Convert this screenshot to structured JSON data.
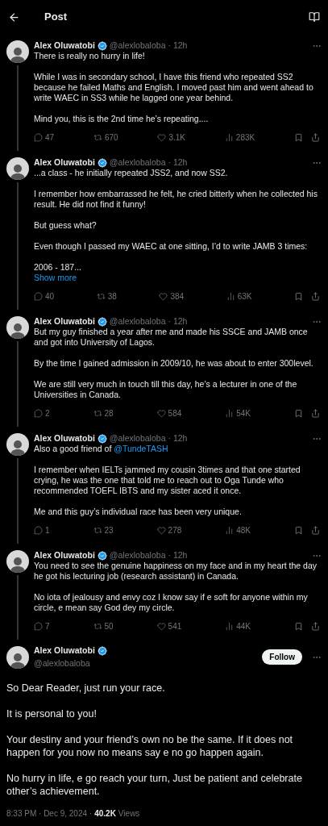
{
  "header": {
    "title": "Post"
  },
  "separator": "·",
  "thread": [
    {
      "name": "Alex Oluwatobi",
      "handle": "@alexlobaloba",
      "time": "12h",
      "paragraphs": [
        "There is really no hurry in life!",
        "While I was in secondary school, I have this friend who repeated SS2 because he failed Maths and English. I moved past him and went ahead to write WAEC in SS3 while he lagged one year behind.",
        "Mind you, this is the 2nd time he’s repeating...."
      ],
      "stats": {
        "replies": "47",
        "reposts": "670",
        "likes": "3.1K",
        "views": "283K"
      }
    },
    {
      "name": "Alex Oluwatobi",
      "handle": "@alexlobaloba",
      "time": "12h",
      "paragraphs": [
        "...a class - he initially repeated JSS2, and now SS2.",
        "I remember how embarrassed he felt, he cried bitterly when he collected his result. He did not find it funny!",
        "But guess what?",
        "Even though I passed my WAEC at one sitting, I’d to write JAMB 3 times:",
        "2006 - 187..."
      ],
      "show_more": "Show more",
      "stats": {
        "replies": "40",
        "reposts": "38",
        "likes": "384",
        "views": "63K"
      }
    },
    {
      "name": "Alex Oluwatobi",
      "handle": "@alexlobaloba",
      "time": "12h",
      "paragraphs": [
        "But my guy finished a year after me and made his SSCE and JAMB once and got into University of Lagos.",
        "By the time I gained admission in 2009/10, he was about to enter 300level.",
        "We are still very much in touch till this day, he’s a lecturer in one of the Universities in Canada."
      ],
      "stats": {
        "replies": "2",
        "reposts": "28",
        "likes": "584",
        "views": "54K"
      }
    },
    {
      "name": "Alex Oluwatobi",
      "handle": "@alexlobaloba",
      "time": "12h",
      "paragraphs": [
        {
          "text": "Also a good friend of",
          "mention": "@TundeTASH"
        },
        "I remember when IELTs jammed my cousin 3times and that one started crying, he was the one that told me to reach out to Oga Tunde who recommended TOEFL IBTS and my sister aced it once.",
        "Me and this guy’s individual race has been very unique."
      ],
      "stats": {
        "replies": "1",
        "reposts": "23",
        "likes": "278",
        "views": "48K"
      }
    },
    {
      "name": "Alex Oluwatobi",
      "handle": "@alexlobaloba",
      "time": "12h",
      "paragraphs": [
        "You need to see the genuine happiness on my face and in my heart the day he got his lecturing job (research assistant) in Canada.",
        "No iota of jealousy and envy coz I know say if e soft for anyone within my circle, e mean say God dey my circle."
      ],
      "stats": {
        "replies": "7",
        "reposts": "50",
        "likes": "541",
        "views": "44K"
      }
    }
  ],
  "main_post": {
    "name": "Alex Oluwatobi",
    "handle": "@alexlobaloba",
    "follow_label": "Follow",
    "paragraphs": [
      "So Dear Reader, just run your race.",
      "It is personal to you!",
      "Your destiny and your friend’s own no be the same. If it does not happen for you now no means say e no go happen again.",
      "No hurry in life, e go reach your turn, Just be patient and celebrate other’s achievement."
    ],
    "timestamp": "8:33 PM · Dec 9, 2024 ·",
    "views": "40.2K",
    "views_label": "Views"
  }
}
